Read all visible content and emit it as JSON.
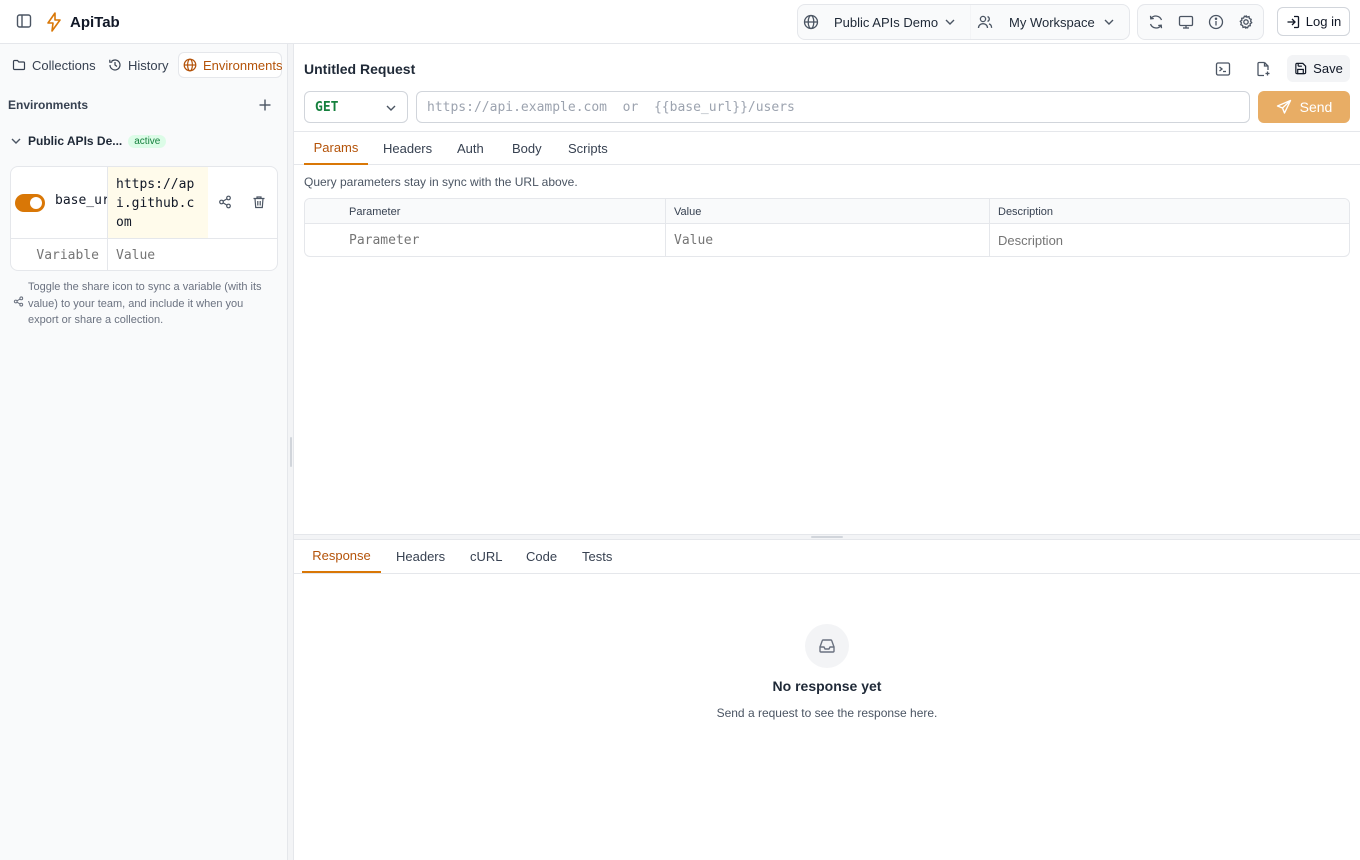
{
  "app": {
    "name": "ApiTab"
  },
  "header": {
    "collection_select": "Public APIs Demo",
    "workspace_select": "My Workspace",
    "login_label": "Log in"
  },
  "sidebar": {
    "tabs": [
      {
        "label": "Collections"
      },
      {
        "label": "History"
      },
      {
        "label": "Environments"
      }
    ],
    "section_title": "Environments",
    "environment": {
      "name": "Public APIs De...",
      "badge": "active",
      "variable": {
        "key": "base_url",
        "value": "https://api.github.com",
        "enabled": true
      },
      "new_key_placeholder": "Variable",
      "new_value_placeholder": "Value"
    },
    "hint": "Toggle the share icon to sync a variable (with its value) to your team, and include it when you export or share a collection."
  },
  "request": {
    "title": "Untitled Request",
    "save_label": "Save",
    "method": "GET",
    "url_placeholder": "https://api.example.com  or  {{base_url}}/users",
    "send_label": "Send",
    "tabs": [
      {
        "label": "Params"
      },
      {
        "label": "Headers"
      },
      {
        "label": "Auth"
      },
      {
        "label": "Body"
      },
      {
        "label": "Scripts"
      }
    ],
    "params_hint": "Query parameters stay in sync with the URL above.",
    "params_table": {
      "headers": [
        "Parameter",
        "Value",
        "Description"
      ],
      "placeholders": [
        "Parameter",
        "Value",
        "Description"
      ]
    }
  },
  "response": {
    "tabs": [
      {
        "label": "Response"
      },
      {
        "label": "Headers"
      },
      {
        "label": "cURL"
      },
      {
        "label": "Code"
      },
      {
        "label": "Tests"
      }
    ],
    "empty_title": "No response yet",
    "empty_subtitle": "Send a request to see the response here."
  },
  "colors": {
    "accent": "#d97706",
    "send_button": "#e8ad65",
    "method_get": "#15803d",
    "active_badge_bg": "#dcfce7",
    "active_badge_text": "#15803d"
  }
}
